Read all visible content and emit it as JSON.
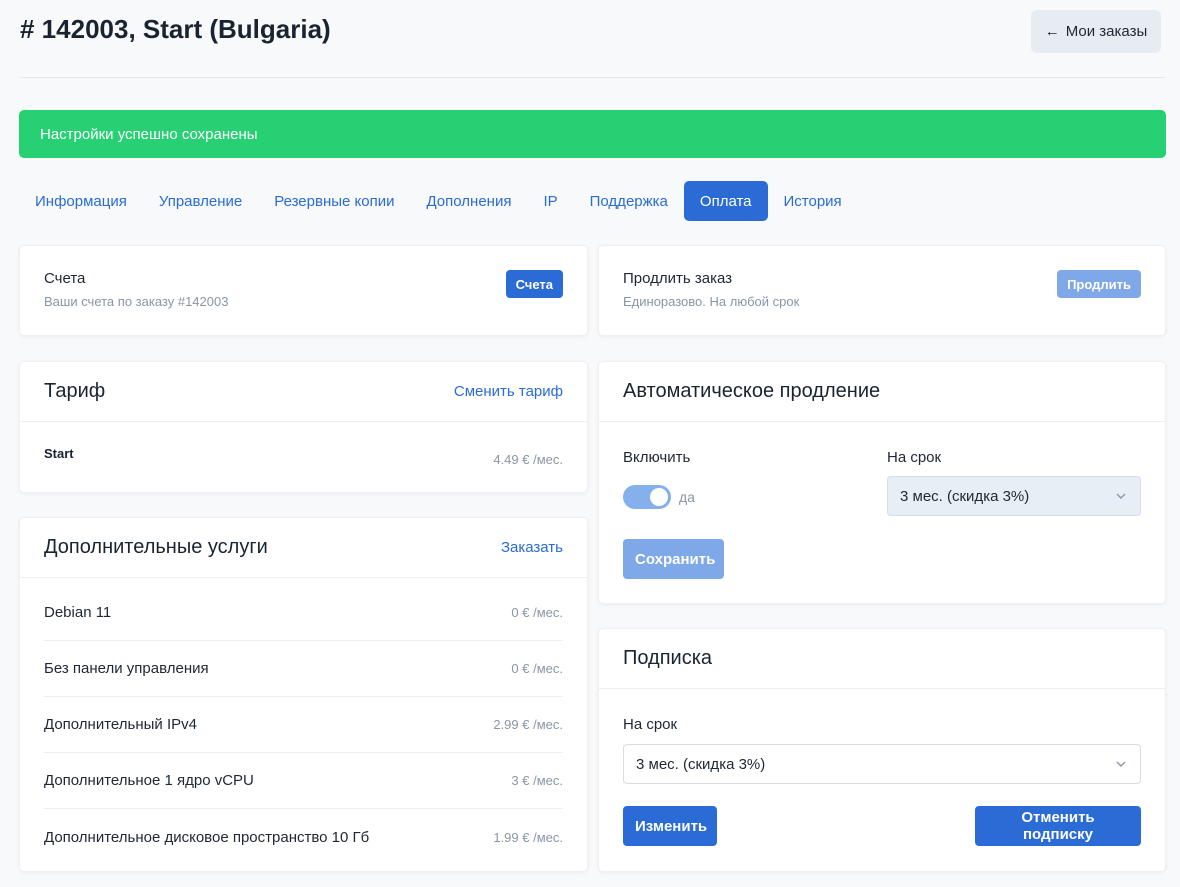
{
  "page": {
    "title": "# 142003, Start (Bulgaria)"
  },
  "header": {
    "back_label": "Мои заказы"
  },
  "alert": {
    "text": "Настройки успешно сохранены"
  },
  "tabs": [
    {
      "label": "Информация"
    },
    {
      "label": "Управление"
    },
    {
      "label": "Резервные копии"
    },
    {
      "label": "Дополнения"
    },
    {
      "label": "IP"
    },
    {
      "label": "Поддержка"
    },
    {
      "label": "Оплата",
      "active": true
    },
    {
      "label": "История"
    }
  ],
  "invoices": {
    "title": "Счета",
    "subtitle": "Ваши счета по заказу #142003",
    "button": "Счета"
  },
  "renew": {
    "title": "Продлить заказ",
    "subtitle": "Единоразово. На любой срок",
    "button": "Продлить"
  },
  "tariff": {
    "title": "Тариф",
    "change_link": "Сменить тариф",
    "name": "Start",
    "price": "4.49 € /мес."
  },
  "addons": {
    "title": "Дополнительные услуги",
    "order_link": "Заказать",
    "items": [
      {
        "name": "Debian 11",
        "price": "0 € /мес."
      },
      {
        "name": "Без панели управления",
        "price": "0 € /мес."
      },
      {
        "name": "Дополнительный IPv4",
        "price": "2.99 € /мес."
      },
      {
        "name": "Дополнительное 1 ядро vCPU",
        "price": "3 € /мес."
      },
      {
        "name": "Дополнительное дисковое пространство 10 Гб",
        "price": "1.99 € /мес."
      }
    ]
  },
  "autorenew": {
    "title": "Автоматическое продление",
    "enable_label": "Включить",
    "toggle_state": "да",
    "term_label": "На срок",
    "term_value": "3 мес. (скидка 3%)",
    "save_button": "Сохранить"
  },
  "subscription": {
    "title": "Подписка",
    "term_label": "На срок",
    "term_value": "3 мес. (скидка 3%)",
    "change_button": "Изменить",
    "cancel_button": "Отменить подписку"
  },
  "colors": {
    "primary": "#2a6bd6",
    "success": "#28d074",
    "disabled": "#7ea8e8"
  },
  "icons": {
    "back": "arrow-left-icon",
    "select": "chevron-down-icon"
  }
}
